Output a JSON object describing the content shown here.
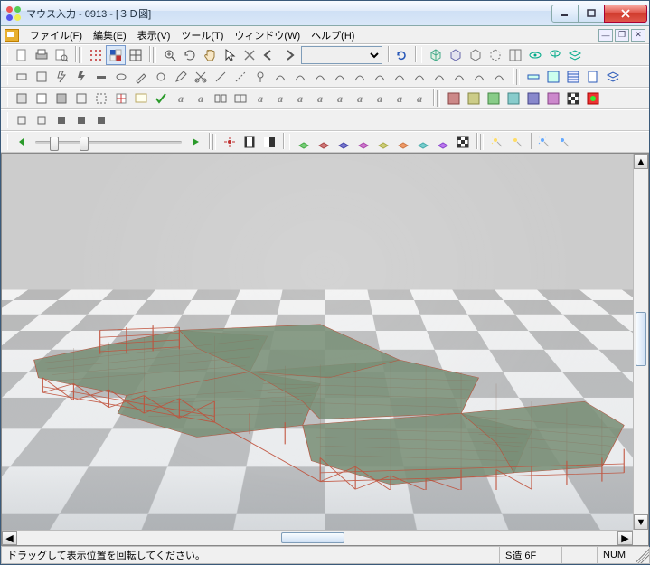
{
  "window": {
    "title": "マウス入力 - 0913 - [３Ｄ図]"
  },
  "menu": {
    "items": [
      "ファイル(F)",
      "編集(E)",
      "表示(V)",
      "ツール(T)",
      "ウィンドウ(W)",
      "ヘルプ(H)"
    ]
  },
  "toolbars": {
    "dropdown_value": ""
  },
  "slider": {
    "play_icon": "play"
  },
  "status": {
    "message": "ドラッグして表示位置を回転してください。",
    "structure": "S造 6F",
    "caps": "",
    "num": "NUM"
  },
  "icons": {
    "row1": [
      "new",
      "print",
      "preview",
      "",
      "grid-dot",
      "grid-block",
      "grid-wire",
      "",
      "zoom-in",
      "rotate",
      "hand",
      "arrow",
      "x",
      "back",
      "fwd",
      "dropdown",
      "",
      "refresh",
      "",
      "cube1",
      "cube2",
      "cube3",
      "cube4",
      "cube5",
      "split",
      "spin",
      "layers"
    ],
    "row2": [
      "rect1",
      "rect2",
      "bolt1",
      "bar1",
      "bar2",
      "oval",
      "knife",
      "grab",
      "pen",
      "cut",
      "line",
      "dline",
      "pin",
      "curve1",
      "curve2",
      "curve3",
      "curve4",
      "curve5",
      "curve6",
      "curve7",
      "curve8",
      "curve9",
      "curve10",
      "curve11",
      "curve12",
      "beam1",
      "beam2",
      "panel1",
      "panel2",
      "doc",
      "layers2"
    ],
    "row3": [
      "sq1",
      "sq2",
      "sq3",
      "sq4",
      "sq5",
      "sq6",
      "note",
      "check",
      "text-a",
      "text-b",
      "grp1",
      "grp2",
      "text-c",
      "text-d",
      "text-e",
      "text-f",
      "text-g",
      "text-h",
      "text-i",
      "text-j",
      "text-k",
      "",
      "fill1",
      "fill2",
      "fill3",
      "fill4",
      "fill5",
      "fill6",
      "fill7",
      "flag"
    ],
    "row4": [
      "b1",
      "b2",
      "b3",
      "b4",
      "b5"
    ],
    "row5": [
      "back",
      "slider",
      "play",
      "",
      "target",
      "film",
      "flag2",
      "",
      "p1",
      "p2",
      "p3",
      "p4",
      "p5",
      "p6",
      "p7",
      "p8",
      "p9",
      "checker",
      "",
      "l1",
      "l2",
      "",
      "l3",
      "l4"
    ]
  }
}
